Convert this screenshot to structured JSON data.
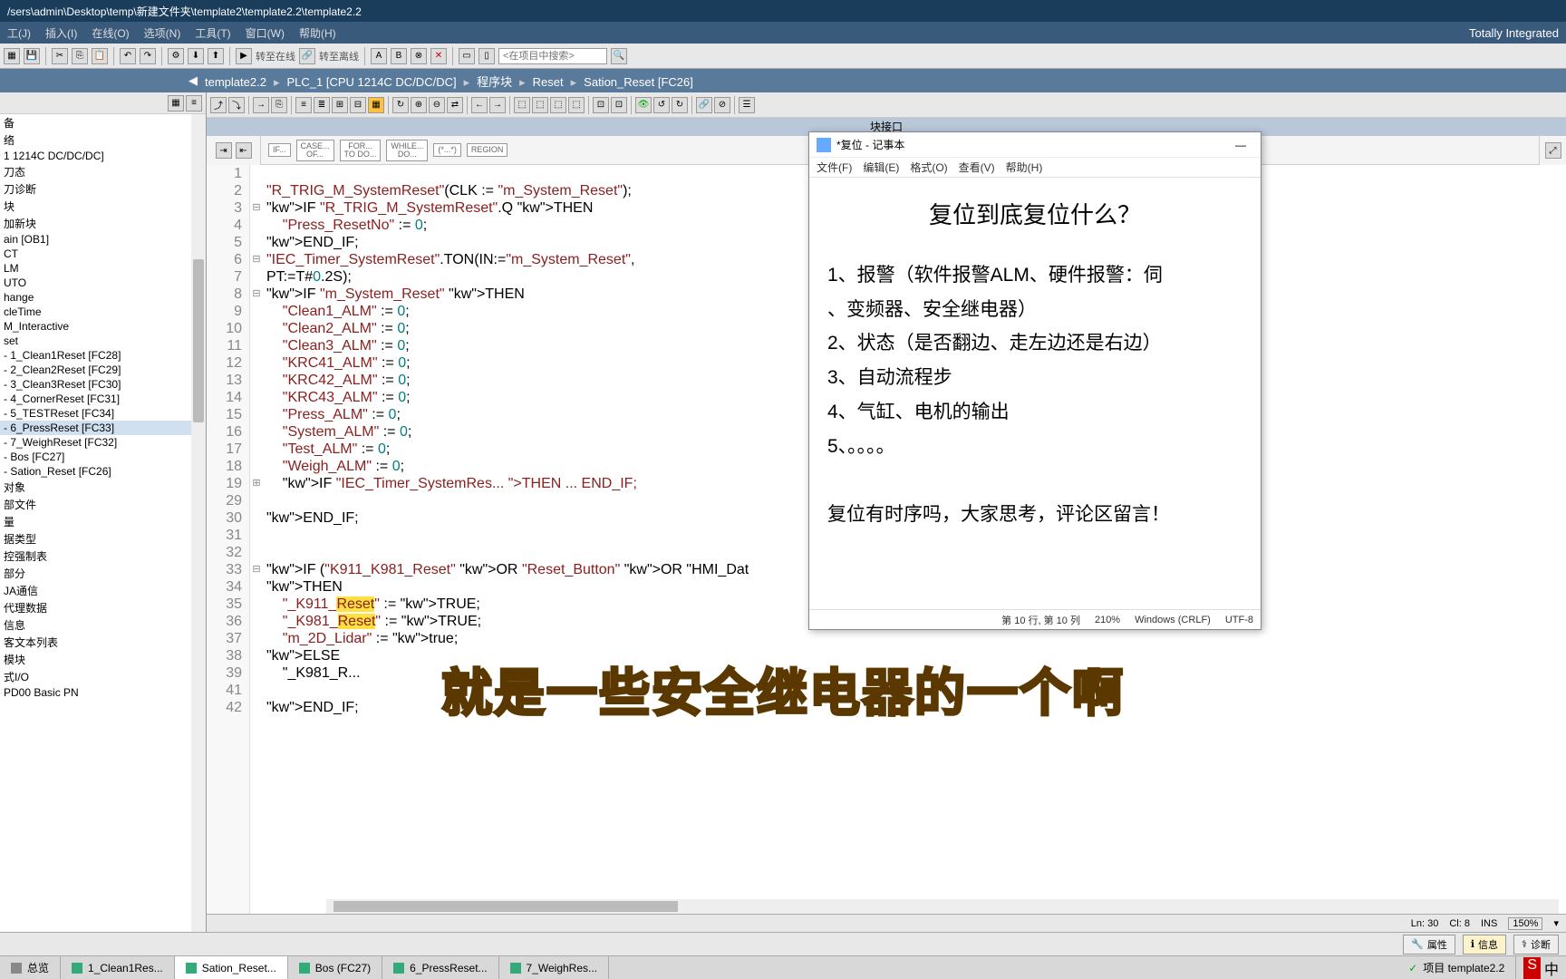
{
  "titlebar": "/sers\\admin\\Desktop\\temp\\新建文件夹\\template2\\template2.2\\template2.2",
  "menus": [
    "工(J)",
    "插入(I)",
    "在线(O)",
    "选项(N)",
    "工具(T)",
    "窗口(W)",
    "帮助(H)"
  ],
  "brand": "Totally Integrated",
  "toolbar_search_placeholder": "<在项目中搜索>",
  "toolbar_labels": {
    "goto_online": "转至在线",
    "goto_offline": "转至离线"
  },
  "breadcrumb": [
    "template2.2",
    "PLC_1 [CPU 1214C DC/DC/DC]",
    "程序块",
    "Reset",
    "Sation_Reset [FC26]"
  ],
  "tree": [
    "备",
    "络",
    "1 1214C DC/DC/DC]",
    "刀态",
    "刀诊断",
    "块",
    "加新块",
    "ain [OB1]",
    "CT",
    "LM",
    "UTO",
    "hange",
    "cleTime",
    "M_Interactive",
    "set",
    "- 1_Clean1Reset [FC28]",
    "- 2_Clean2Reset [FC29]",
    "- 3_Clean3Reset [FC30]",
    "- 4_CornerReset [FC31]",
    "- 5_TESTReset [FC34]",
    "- 6_PressReset [FC33]",
    "- 7_WeighReset [FC32]",
    "- Bos [FC27]",
    "- Sation_Reset [FC26]",
    "对象",
    "部文件",
    "量",
    "据类型",
    "控强制表",
    "部分",
    "JA通信",
    "代理数据",
    "信息",
    "客文本列表",
    "模块",
    "式I/O",
    "PD00 Basic PN"
  ],
  "tree_selected_index": 20,
  "block_header": "块接口",
  "kw_boxes": [
    "IF...",
    "CASE...\nOF...",
    "FOR...\nTO DO...",
    "WHILE...\nDO...",
    "(*...*)",
    "REGION"
  ],
  "code": [
    {
      "n": 1,
      "t": ""
    },
    {
      "n": 2,
      "t": "\"R_TRIG_M_SystemReset\"(CLK := \"m_System_Reset\");"
    },
    {
      "n": 3,
      "t": "IF \"R_TRIG_M_SystemReset\".Q THEN",
      "f": "⊟"
    },
    {
      "n": 4,
      "t": "    \"Press_ResetNo\" := 0;"
    },
    {
      "n": 5,
      "t": "END_IF;"
    },
    {
      "n": 6,
      "t": "\"IEC_Timer_SystemReset\".TON(IN:=\"m_System_Reset\",",
      "f": "⊟"
    },
    {
      "n": 7,
      "t": "PT:=T#0.2S);"
    },
    {
      "n": 8,
      "t": "IF \"m_System_Reset\" THEN",
      "f": "⊟"
    },
    {
      "n": 9,
      "t": "    \"Clean1_ALM\" := 0;"
    },
    {
      "n": 10,
      "t": "    \"Clean2_ALM\" := 0;"
    },
    {
      "n": 11,
      "t": "    \"Clean3_ALM\" := 0;"
    },
    {
      "n": 12,
      "t": "    \"KRC41_ALM\" := 0;"
    },
    {
      "n": 13,
      "t": "    \"KRC42_ALM\" := 0;"
    },
    {
      "n": 14,
      "t": "    \"KRC43_ALM\" := 0;"
    },
    {
      "n": 15,
      "t": "    \"Press_ALM\" := 0;"
    },
    {
      "n": 16,
      "t": "    \"System_ALM\" := 0;"
    },
    {
      "n": 17,
      "t": "    \"Test_ALM\" := 0;"
    },
    {
      "n": 18,
      "t": "    \"Weigh_ALM\" := 0;"
    },
    {
      "n": 19,
      "t": "    IF \"IEC_Timer_SystemRes... THEN ... END_IF;",
      "f": "⊞"
    },
    {
      "n": 29,
      "t": ""
    },
    {
      "n": 30,
      "t": "END_IF;"
    },
    {
      "n": 31,
      "t": ""
    },
    {
      "n": 32,
      "t": ""
    },
    {
      "n": 33,
      "t": "IF (\"K911_K981_Reset\" OR \"Reset_Button\" OR \"HMI_Dat",
      "f": "⊟"
    },
    {
      "n": 34,
      "t": "THEN"
    },
    {
      "n": 35,
      "t": "    \"_K911_Reset\" := TRUE;",
      "hl": "Reset"
    },
    {
      "n": 36,
      "t": "    \"_K981_Reset\" := TRUE;",
      "hl": "Reset"
    },
    {
      "n": 37,
      "t": "    \"m_2D_Lidar\" := true;"
    },
    {
      "n": 38,
      "t": "ELSE"
    },
    {
      "n": 39,
      "t": "    \"_K981_R..."
    },
    {
      "n": 41,
      "t": ""
    },
    {
      "n": 42,
      "t": "END_IF;"
    }
  ],
  "notepad": {
    "title": "*复位 - 记事本",
    "menus": [
      "文件(F)",
      "编辑(E)",
      "格式(O)",
      "查看(V)",
      "帮助(H)"
    ],
    "heading": "复位到底复位什么？",
    "lines": [
      "1、报警（软件报警ALM、硬件报警：伺",
      "、变频器、安全继电器）",
      "2、状态（是否翻边、走左边还是右边）",
      "3、自动流程步",
      "4、气缸、电机的输出",
      "5、。。。。",
      "",
      "复位有时序吗，大家思考，评论区留言！"
    ],
    "status": {
      "pos": "第 10 行, 第 10 列",
      "zoom": "210%",
      "eol": "Windows (CRLF)",
      "enc": "UTF-8"
    }
  },
  "subtitle": "就是一些安全继电器的一个啊",
  "status": {
    "ln": "Ln: 30",
    "cl": "Cl: 8",
    "mode": "INS",
    "zoom": "150%"
  },
  "side_buttons": [
    "属性",
    "信息",
    "诊断"
  ],
  "project_label": "项目 template2.2",
  "bottom_tabs": [
    {
      "label": "总览",
      "icon": "#888"
    },
    {
      "label": "1_Clean1Res...",
      "icon": "#3a7"
    },
    {
      "label": "Sation_Reset...",
      "icon": "#3a7",
      "active": true
    },
    {
      "label": "Bos (FC27)",
      "icon": "#3a7"
    },
    {
      "label": "6_PressReset...",
      "icon": "#3a7"
    },
    {
      "label": "7_WeighRes...",
      "icon": "#3a7"
    }
  ]
}
